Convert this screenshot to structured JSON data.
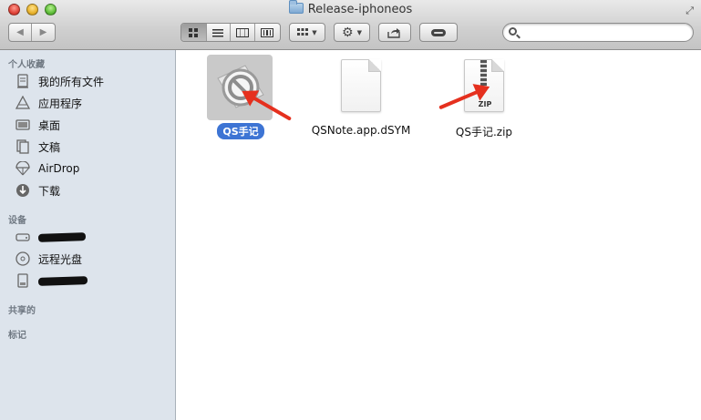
{
  "window": {
    "title": "Release-iphoneos"
  },
  "toolbar": {
    "icons": [
      "back-icon",
      "forward-icon",
      "icon-view-icon",
      "list-view-icon",
      "column-view-icon",
      "coverflow-view-icon",
      "arrange-icon",
      "action-gear-icon",
      "share-icon",
      "tag-icon"
    ],
    "search": {
      "value": "",
      "placeholder": ""
    }
  },
  "sidebar": {
    "favorites_header": "个人收藏",
    "favorites": [
      {
        "label": "我的所有文件",
        "icon": "all-files-icon"
      },
      {
        "label": "应用程序",
        "icon": "applications-icon"
      },
      {
        "label": "桌面",
        "icon": "desktop-icon"
      },
      {
        "label": "文稿",
        "icon": "documents-icon"
      },
      {
        "label": "AirDrop",
        "icon": "airdrop-icon"
      },
      {
        "label": "下载",
        "icon": "downloads-icon"
      }
    ],
    "devices_header": "设备",
    "devices": [
      {
        "label": "",
        "icon": "drive-icon",
        "redacted": true
      },
      {
        "label": "远程光盘",
        "icon": "remote-disc-icon"
      },
      {
        "label": "",
        "icon": "disk-icon",
        "redacted": true
      }
    ],
    "shared_header": "共享的",
    "tags_header": "标记"
  },
  "files": [
    {
      "name": "QS手记",
      "type": "app",
      "selected": true
    },
    {
      "name": "QSNote.app.dSYM",
      "type": "document",
      "selected": false
    },
    {
      "name": "QS手记.zip",
      "type": "zip",
      "selected": false,
      "badge": "ZIP"
    }
  ],
  "colors": {
    "sidebar_bg": "#dde4ec",
    "selection_blue": "#3d74d4",
    "annotation_red": "#e5301e"
  }
}
